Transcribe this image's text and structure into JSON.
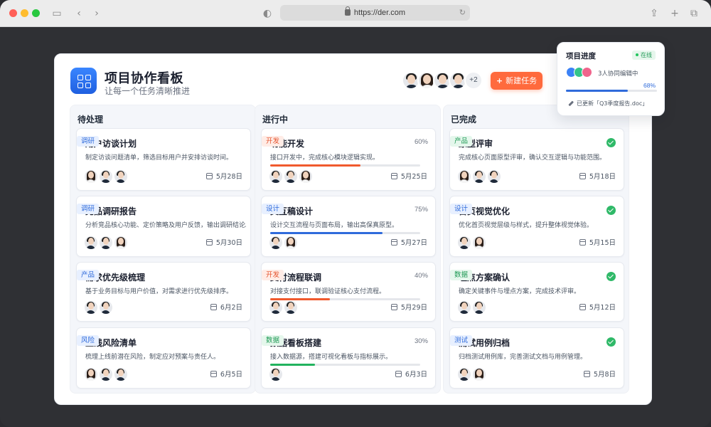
{
  "browser": {
    "url": "https://der.com"
  },
  "header": {
    "title": "项目协作看板",
    "subtitle": "让每一个任务清晰推进",
    "members_more": "+2",
    "new_task_label": "新建任务"
  },
  "columns": [
    {
      "title": "待处理",
      "cards": [
        {
          "title": "用户访谈计划",
          "tag": "调研",
          "tag_color": "blue",
          "desc": "制定访谈问题清单，筛选目标用户并安排访谈时间。",
          "date": "5月28日",
          "avatars": [
            "f",
            "m",
            "m"
          ]
        },
        {
          "title": "竞品调研报告",
          "tag": "调研",
          "tag_color": "blue",
          "desc": "分析竞品核心功能、定价策略及用户反馈，输出调研结论。",
          "date": "5月30日",
          "avatars": [
            "m",
            "m",
            "f"
          ]
        },
        {
          "title": "需求优先级梳理",
          "tag": "产品",
          "tag_color": "blue",
          "desc": "基于业务目标与用户价值，对需求进行优先级排序。",
          "date": "6月2日",
          "avatars": [
            "m",
            "m"
          ]
        },
        {
          "title": "上线风险清单",
          "tag": "风险",
          "tag_color": "blue",
          "desc": "梳理上线前潜在风险，制定应对预案与责任人。",
          "date": "6月5日",
          "avatars": [
            "f",
            "m",
            "m"
          ]
        }
      ]
    },
    {
      "title": "进行中",
      "cards": [
        {
          "title": "功能开发",
          "tag": "开发",
          "tag_color": "red",
          "desc": "接口开发中，完成核心模块逻辑实现。",
          "percent": "60%",
          "progress": 0.6,
          "bar_color": "#f05a2e",
          "date": "5月25日",
          "avatars": [
            "m",
            "m",
            "f"
          ]
        },
        {
          "title": "交互稿设计",
          "tag": "设计",
          "tag_color": "blue",
          "desc": "设计交互流程与页面布局，输出高保真原型。",
          "percent": "75%",
          "progress": 0.75,
          "bar_color": "#2f6bdb",
          "date": "5月27日",
          "avatars": [
            "m",
            "f"
          ]
        },
        {
          "title": "支付流程联调",
          "tag": "开发",
          "tag_color": "red",
          "desc": "对接支付接口，联调验证核心支付流程。",
          "percent": "40%",
          "progress": 0.4,
          "bar_color": "#f05a2e",
          "date": "5月29日",
          "avatars": [
            "m",
            "m"
          ]
        },
        {
          "title": "数据看板搭建",
          "tag": "数据",
          "tag_color": "green",
          "desc": "接入数据源，搭建可视化看板与指标展示。",
          "percent": "30%",
          "progress": 0.3,
          "bar_color": "#22b35e",
          "date": "6月3日",
          "avatars": [
            "m"
          ]
        }
      ]
    },
    {
      "title": "已完成",
      "cards": [
        {
          "title": "原型评审",
          "tag": "产品",
          "tag_color": "green",
          "desc": "完成核心页面原型评审，确认交互逻辑与功能范围。",
          "date": "5月18日",
          "avatars": [
            "f",
            "m",
            "m"
          ]
        },
        {
          "title": "首页视觉优化",
          "tag": "设计",
          "tag_color": "blue",
          "desc": "优化首页视觉层级与样式，提升整体视觉体验。",
          "date": "5月15日",
          "avatars": [
            "m",
            "f"
          ]
        },
        {
          "title": "埋点方案确认",
          "tag": "数据",
          "tag_color": "green",
          "desc": "确定关键事件与埋点方案，完成技术评审。",
          "date": "5月12日",
          "avatars": [
            "m",
            "m"
          ]
        },
        {
          "title": "测试用例归档",
          "tag": "测试",
          "tag_color": "blue",
          "desc": "归档测试用例库，完善测试文档与用例管理。",
          "date": "5月8日",
          "avatars": [
            "m",
            "f"
          ]
        }
      ]
    }
  ],
  "progress_popup": {
    "title": "项目进度",
    "status": "在线",
    "collab_text": "3人协同编辑中",
    "percent": "68%",
    "progress": 0.68,
    "updated_text": "已更新「Q3季度报告.doc」"
  }
}
